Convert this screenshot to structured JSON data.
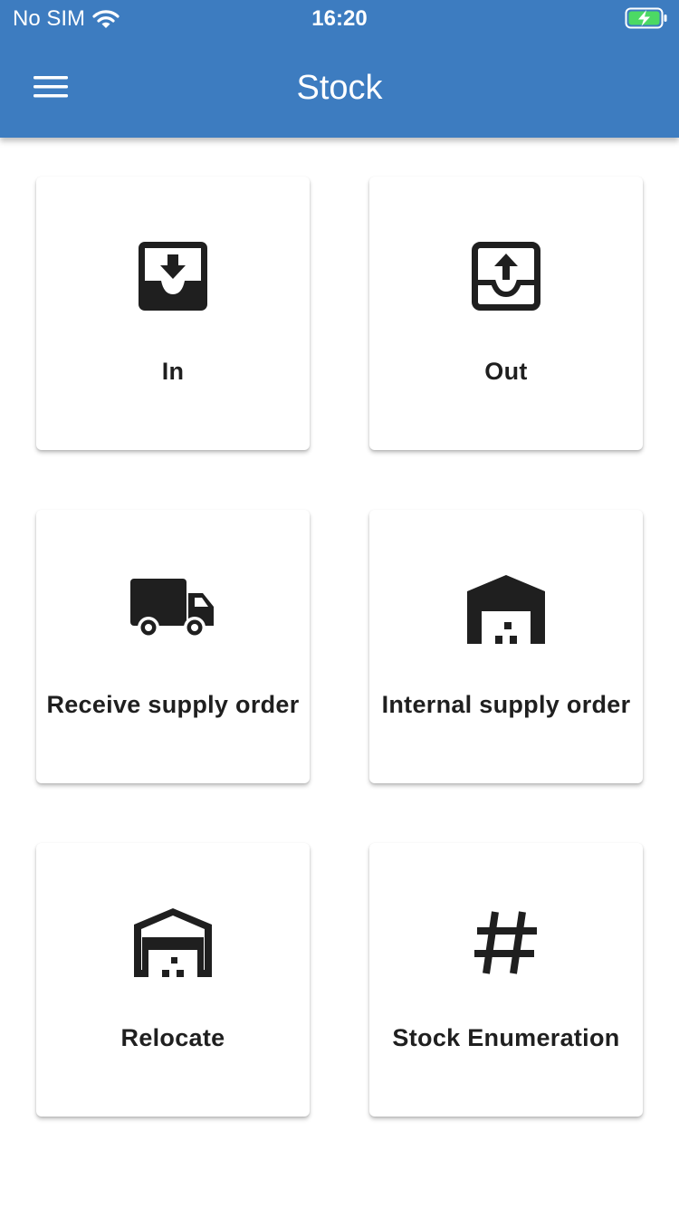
{
  "status_bar": {
    "carrier": "No SIM",
    "time": "16:20",
    "wifi_icon": "wifi-icon",
    "battery_icon": "battery-charging-icon",
    "battery_color": "#4cd964"
  },
  "app_bar": {
    "title": "Stock",
    "menu_icon": "menu-icon",
    "background_color": "#3d7cc0"
  },
  "tiles": [
    {
      "label": "In",
      "icon": "inbox-arrow-down-icon"
    },
    {
      "label": "Out",
      "icon": "inbox-arrow-up-icon"
    },
    {
      "label": "Receive supply order",
      "icon": "truck-icon"
    },
    {
      "label": "Internal supply order",
      "icon": "warehouse-filled-icon"
    },
    {
      "label": "Relocate",
      "icon": "warehouse-outline-icon"
    },
    {
      "label": "Stock Enumeration",
      "icon": "hashtag-icon"
    }
  ]
}
